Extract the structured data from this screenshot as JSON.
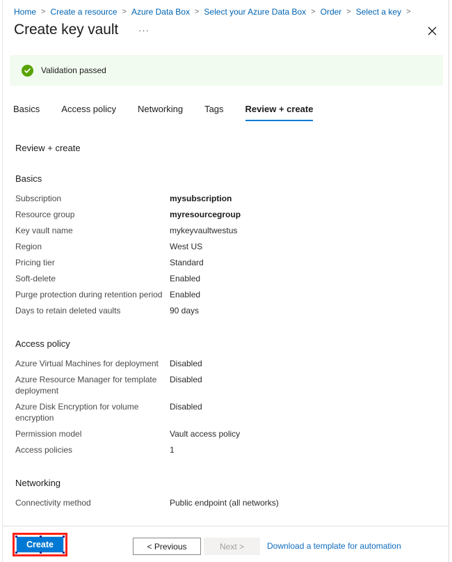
{
  "breadcrumb": {
    "items": [
      "Home",
      "Create a resource",
      "Azure Data Box",
      "Select your Azure Data Box",
      "Order",
      "Select a key"
    ],
    "separator": ">"
  },
  "header": {
    "title": "Create key vault",
    "ellipsis": "···",
    "close_label": "Close"
  },
  "validation": {
    "message": "Validation passed",
    "icon": "check-circle-icon",
    "background": "#f2fbf0",
    "icon_color": "#57a300"
  },
  "tabs": [
    {
      "label": "Basics",
      "active": false
    },
    {
      "label": "Access policy",
      "active": false
    },
    {
      "label": "Networking",
      "active": false
    },
    {
      "label": "Tags",
      "active": false
    },
    {
      "label": "Review + create",
      "active": true
    }
  ],
  "accent": "#0078d4",
  "main": {
    "lead": "Review + create",
    "sections": [
      {
        "title": "Basics",
        "rows": [
          {
            "key": "Subscription",
            "value": "mysubscription",
            "bold": true
          },
          {
            "key": "Resource group",
            "value": "myresourcegroup",
            "bold": true
          },
          {
            "key": "Key vault name",
            "value": "mykeyvaultwestus",
            "bold": false
          },
          {
            "key": "Region",
            "value": "West US",
            "bold": false
          },
          {
            "key": "Pricing tier",
            "value": "Standard",
            "bold": false
          },
          {
            "key": "Soft-delete",
            "value": "Enabled",
            "bold": false
          },
          {
            "key": "Purge protection during retention period",
            "value": "Enabled",
            "bold": false
          },
          {
            "key": "Days to retain deleted vaults",
            "value": "90 days",
            "bold": false
          }
        ]
      },
      {
        "title": "Access policy",
        "rows": [
          {
            "key": "Azure Virtual Machines for deployment",
            "value": "Disabled",
            "bold": false
          },
          {
            "key": "Azure Resource Manager for template deployment",
            "value": "Disabled",
            "bold": false
          },
          {
            "key": "Azure Disk Encryption for volume encryption",
            "value": "Disabled",
            "bold": false
          },
          {
            "key": "Permission model",
            "value": "Vault access policy",
            "bold": false
          },
          {
            "key": "Access policies",
            "value": "1",
            "bold": false
          }
        ]
      },
      {
        "title": "Networking",
        "rows": [
          {
            "key": "Connectivity method",
            "value": "Public endpoint (all networks)",
            "bold": false
          }
        ]
      }
    ]
  },
  "footer": {
    "create_label": "Create",
    "previous_label": "< Previous",
    "next_label": "Next >",
    "download_label": "Download a template for automation",
    "highlight_color": "#ff2116"
  }
}
